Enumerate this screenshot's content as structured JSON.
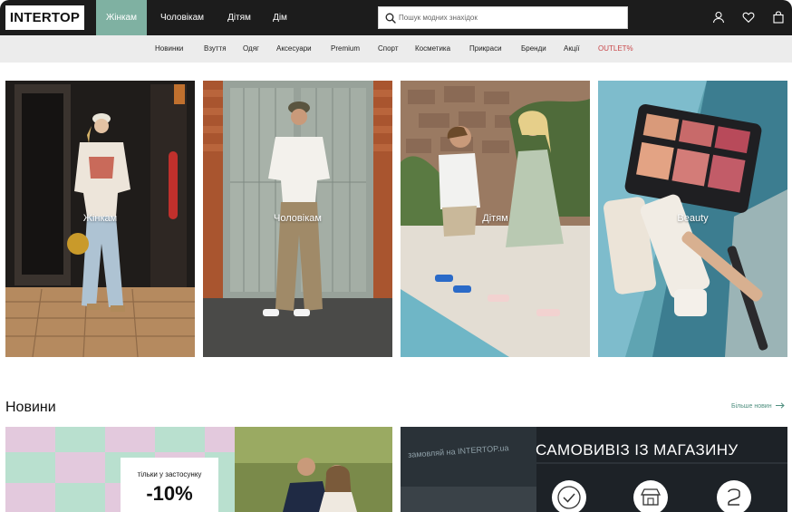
{
  "header": {
    "logo_text": "INTERTOP",
    "nav": [
      {
        "label": "Жінкам",
        "active": true
      },
      {
        "label": "Чоловікам",
        "active": false
      },
      {
        "label": "Дітям",
        "active": false
      },
      {
        "label": "Дім",
        "active": false
      }
    ],
    "search_placeholder": "Пошук модних знахідок",
    "icons": [
      "account-icon",
      "heart-icon",
      "bag-icon"
    ],
    "accent_color": "#7fb1a2"
  },
  "categories": [
    "Новинки",
    "Взуття",
    "Одяг",
    "Аксесуари",
    "Premium",
    "Спорт",
    "Косметика",
    "Прикраси",
    "Бренди",
    "Акції",
    "OUTLET%"
  ],
  "outlet_color": "#c9474a",
  "tiles": [
    {
      "label": "Жінкам"
    },
    {
      "label": "Чоловікам"
    },
    {
      "label": "Дітям"
    },
    {
      "label": "Beauty"
    }
  ],
  "news": {
    "title": "Новини",
    "more_link": "Більше новин",
    "promo_line1": "тільки у застосунку",
    "promo_line2": "-10%",
    "pickup_title": "САМОВИВІЗ ІЗ МАГАЗИНУ",
    "shop_sign": "замовляй на INTERTOP.ua"
  }
}
